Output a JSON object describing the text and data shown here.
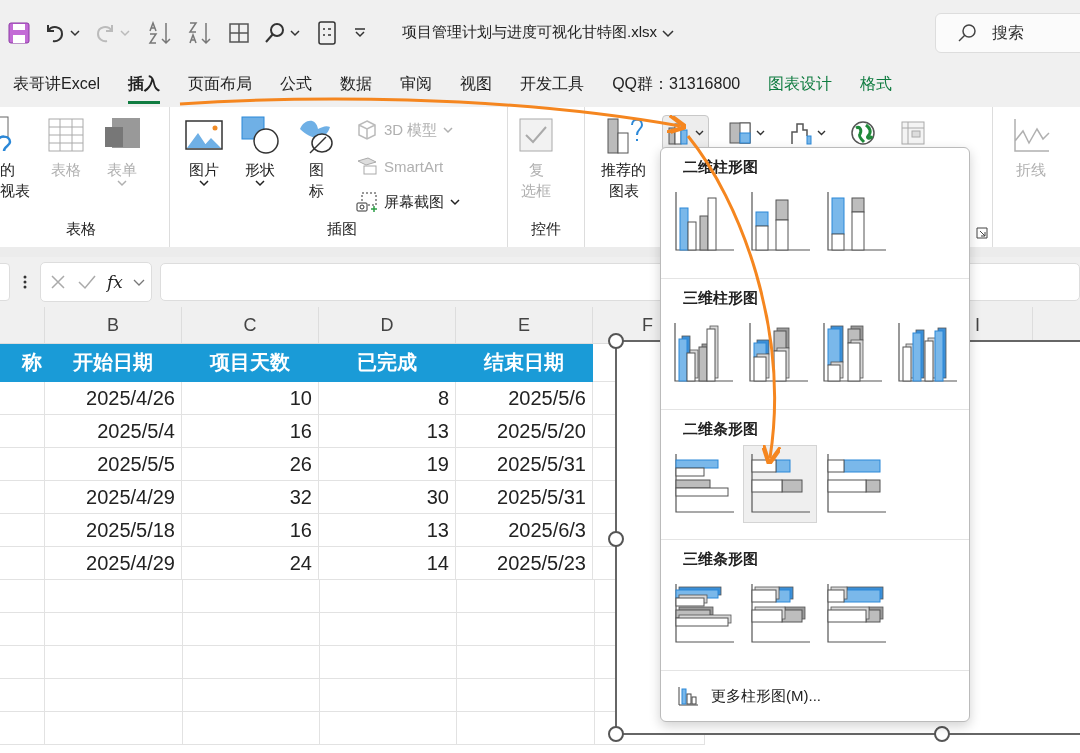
{
  "title_bar": {
    "file_name": "项目管理计划与进度可视化甘特图.xlsx",
    "search": {
      "placeholder": "搜索"
    }
  },
  "tabs": [
    {
      "label": "表哥讲Excel",
      "selected": false,
      "kind": "normal"
    },
    {
      "label": "插入",
      "selected": true,
      "kind": "normal"
    },
    {
      "label": "页面布局",
      "selected": false,
      "kind": "normal"
    },
    {
      "label": "公式",
      "selected": false,
      "kind": "normal"
    },
    {
      "label": "数据",
      "selected": false,
      "kind": "normal"
    },
    {
      "label": "审阅",
      "selected": false,
      "kind": "normal"
    },
    {
      "label": "视图",
      "selected": false,
      "kind": "normal"
    },
    {
      "label": "开发工具",
      "selected": false,
      "kind": "normal"
    },
    {
      "label": "QQ群：31316800",
      "selected": false,
      "kind": "normal"
    },
    {
      "label": "图表设计",
      "selected": false,
      "kind": "contextual"
    },
    {
      "label": "格式",
      "selected": false,
      "kind": "contextual"
    }
  ],
  "ribbon": {
    "groups": [
      {
        "label": "表格",
        "buttons": [
          {
            "kind": "pivot",
            "lines": [
              "的",
              "视表"
            ],
            "disabled": false
          },
          {
            "kind": "table",
            "lines": [
              "表格"
            ],
            "disabled": true
          },
          {
            "kind": "form",
            "lines": [
              "表单"
            ],
            "disabled": true,
            "dropdown": true
          }
        ]
      },
      {
        "label": "插图",
        "buttons": [
          {
            "kind": "picture",
            "lines": [
              "图片"
            ],
            "disabled": false,
            "dropdown": true
          },
          {
            "kind": "shapes",
            "lines": [
              "形状"
            ],
            "disabled": false,
            "dropdown": true
          },
          {
            "kind": "icons",
            "lines": [
              "图",
              "标"
            ],
            "disabled": false
          }
        ],
        "small_buttons": [
          {
            "kind": "model3d",
            "label": "3D 模型",
            "disabled": true,
            "dropdown": true
          },
          {
            "kind": "smartart",
            "label": "SmartArt",
            "disabled": true
          },
          {
            "kind": "screenshot",
            "label": "屏幕截图",
            "disabled": false,
            "dropdown": true
          }
        ]
      },
      {
        "label": "控件",
        "buttons": [
          {
            "kind": "checkbox",
            "lines": [
              "复",
              "选框"
            ],
            "disabled": true
          }
        ]
      },
      {
        "buttons": [
          {
            "kind": "recommended",
            "lines": [
              "推荐的",
              "图表"
            ],
            "disabled": false
          }
        ],
        "chart_buttons": [
          {
            "kind": "column",
            "selected": true
          },
          {
            "kind": "hierarchy",
            "selected": false
          },
          {
            "kind": "waterfall",
            "selected": false
          },
          {
            "kind": "map",
            "selected": false
          },
          {
            "kind": "pivotchart",
            "selected": false
          }
        ],
        "launcher": true
      },
      {
        "buttons": [
          {
            "kind": "line",
            "lines": [
              "折线"
            ],
            "disabled": true
          }
        ]
      }
    ]
  },
  "formula_bar": {
    "fx_label": "fx"
  },
  "sheet": {
    "column_headers": [
      "B",
      "C",
      "D",
      "E",
      "F",
      "I"
    ],
    "header_row": [
      "称",
      "开始日期",
      "项目天数",
      "已完成",
      "结束日期"
    ],
    "rows": [
      [
        "2025/4/26",
        "10",
        "8",
        "2025/5/6"
      ],
      [
        "2025/5/4",
        "16",
        "13",
        "2025/5/20"
      ],
      [
        "2025/5/5",
        "26",
        "19",
        "2025/5/31"
      ],
      [
        "2025/4/29",
        "32",
        "30",
        "2025/5/31"
      ],
      [
        "2025/5/18",
        "16",
        "13",
        "2025/6/3"
      ],
      [
        "2025/4/29",
        "24",
        "14",
        "2025/5/23"
      ]
    ]
  },
  "chart_menu": {
    "sections": [
      {
        "title": "二维柱形图",
        "kind": "column2d",
        "items": [
          {
            "selected": false
          },
          {
            "selected": false
          },
          {
            "selected": false
          }
        ]
      },
      {
        "title": "三维柱形图",
        "kind": "column3d",
        "items": [
          {
            "selected": false
          },
          {
            "selected": false
          },
          {
            "selected": false
          },
          {
            "selected": false
          }
        ]
      },
      {
        "title": "二维条形图",
        "kind": "bar2d",
        "items": [
          {
            "selected": false
          },
          {
            "selected": true
          },
          {
            "selected": false
          }
        ]
      },
      {
        "title": "三维条形图",
        "kind": "bar3d",
        "items": [
          {
            "selected": false
          },
          {
            "selected": false
          },
          {
            "selected": false
          }
        ]
      }
    ],
    "more": "更多柱形图(M)..."
  }
}
